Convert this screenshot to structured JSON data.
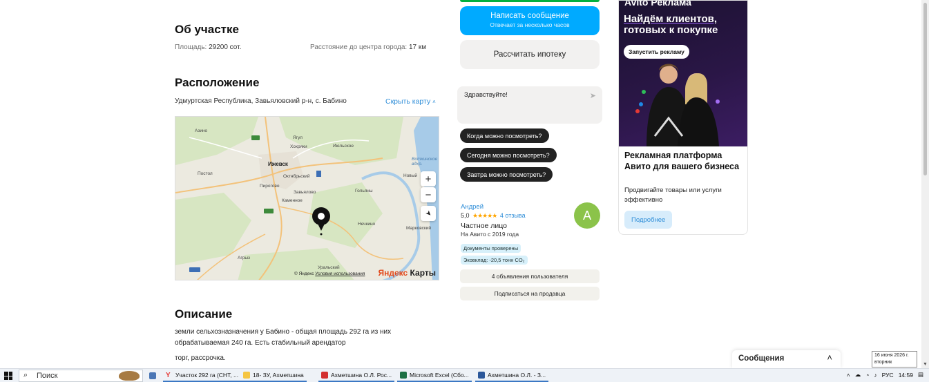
{
  "about": {
    "title": "Об участке",
    "area_label": "Площадь:",
    "area_value": "29200 сот.",
    "distance_label": "Расстояние до центра города:",
    "distance_value": "17 км"
  },
  "location": {
    "title": "Расположение",
    "address": "Удмуртская Республика, Завьяловский р-н, с. Бабино",
    "hide_map": "Скрыть карту",
    "map": {
      "labels": [
        "Азино",
        "Ягул",
        "Хохряки",
        "Июльское",
        "Ижевск",
        "Октябрьский",
        "Постол",
        "Пироговo",
        "Завьялово",
        "Каменное",
        "Гольяны",
        "Новый",
        "Воткинское вдхр.",
        "Нечкино",
        "Марковский",
        "Агрыз",
        "Уральский"
      ],
      "zoom_in": "+",
      "zoom_out": "−",
      "copyright": "© Яндекс",
      "terms": "Условия использования",
      "logo_brand": "Яндекс",
      "logo_product": "Карты"
    }
  },
  "description": {
    "title": "Описание",
    "line1": "земли сельхозназначения у Бабино - общая площадь 292 га из них",
    "line2": "обрабатываемая 240 га. Есть стабильный арендатор",
    "line3": "торг, рассрочка."
  },
  "actions": {
    "message_button": "Написать сообщение",
    "message_sub": "Отвечает за несколько часов",
    "mortgage_button": "Рассчитать ипотеку"
  },
  "chat": {
    "input_value": "Здравствуйте!",
    "quick_replies": [
      "Когда можно посмотреть?",
      "Сегодня можно посмотреть?",
      "Завтра можно посмотреть?"
    ]
  },
  "seller": {
    "name": "Андрей",
    "rating": "5,0",
    "stars": "★★★★★",
    "reviews": "4 отзыва",
    "type": "Частное лицо",
    "since": "На Авито с 2019 года",
    "avatar_letter": "А",
    "badges": [
      "Документы проверены",
      "Эковклад: -20,5 тонн CO₂"
    ],
    "listings_button": "4 объявления пользователя",
    "subscribe_button": "Подписаться на продавца",
    "avatar_color": "#8bc34a"
  },
  "ad": {
    "brand": "Avito Реклама",
    "headline_1": "Найдём клиентов,",
    "headline_2": "готовых к покупке",
    "cta": "Запустить рекламу",
    "title": "Рекламная платформа Авито для вашего бизнеса",
    "text": "Продвигайте товары или услуги эффективно",
    "more": "Подробнее"
  },
  "messages": {
    "label": "Сообщения"
  },
  "tooltip": {
    "date": "16 июня 2026 г.",
    "weekday": "вторник"
  },
  "taskbar": {
    "search_placeholder": "Поиск",
    "items": [
      "Участок 292 га (СНТ, ...",
      "18- ЗУ, Ахметшина",
      "Ахметшина О.Л. Рос...",
      "Microsoft Excel (Сбо...",
      "Ахметшина О.Л. - З..."
    ],
    "language": "РУС",
    "time": "14:59"
  },
  "colors": {
    "accent_blue": "#00aaff",
    "link_blue": "#2f8ed8",
    "star": "#ffa500"
  }
}
